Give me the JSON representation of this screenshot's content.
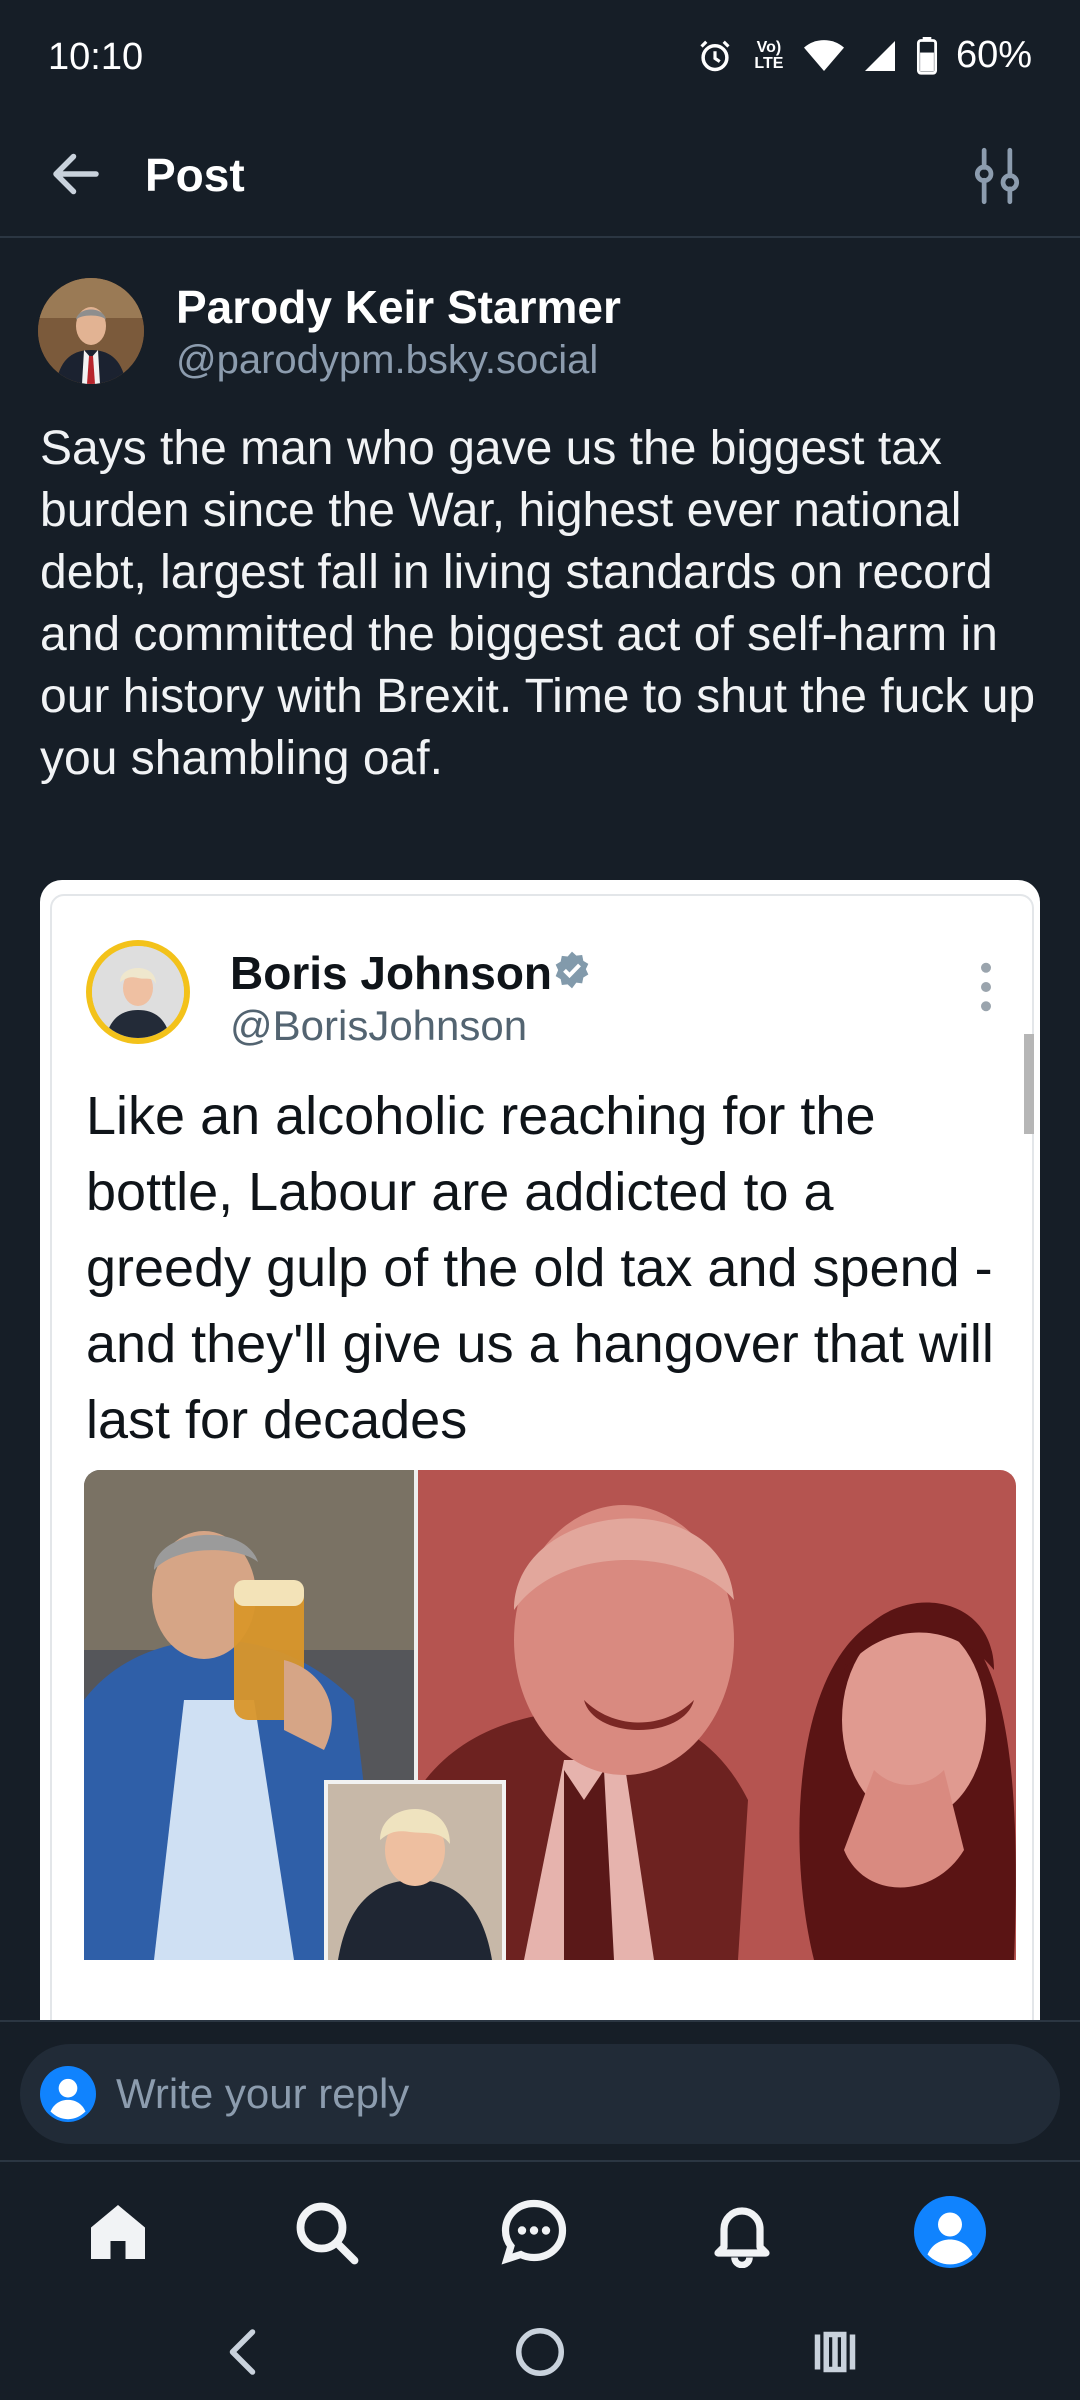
{
  "status": {
    "time": "10:10",
    "volte": "Vo) LTE",
    "battery": "60%"
  },
  "header": {
    "title": "Post"
  },
  "author": {
    "name": "Parody Keir Starmer",
    "handle": "@parodypm.bsky.social"
  },
  "post": {
    "text": "Says the man who gave us the biggest tax burden since the War, highest ever national debt, largest fall in living standards on record and committed the biggest act of self-harm in our history with Brexit. Time to shut the fuck up you shambling oaf."
  },
  "embed": {
    "name": "Boris Johnson",
    "handle": "@BorisJohnson",
    "text": "Like an alcoholic reaching for the bottle, Labour are addicted to a greedy gulp of the old tax and spend - and they'll give us a hangover that will last for decades"
  },
  "reply": {
    "placeholder": "Write your reply"
  },
  "colors": {
    "background": "#161e27",
    "accent": "#1083fe",
    "muted": "#8c9cae"
  },
  "icons": {
    "back": "arrow-left-icon",
    "filter": "filter-icon",
    "home": "home-icon",
    "search": "search-icon",
    "chat": "chat-icon",
    "notifications": "bell-icon",
    "profile": "profile-icon"
  }
}
